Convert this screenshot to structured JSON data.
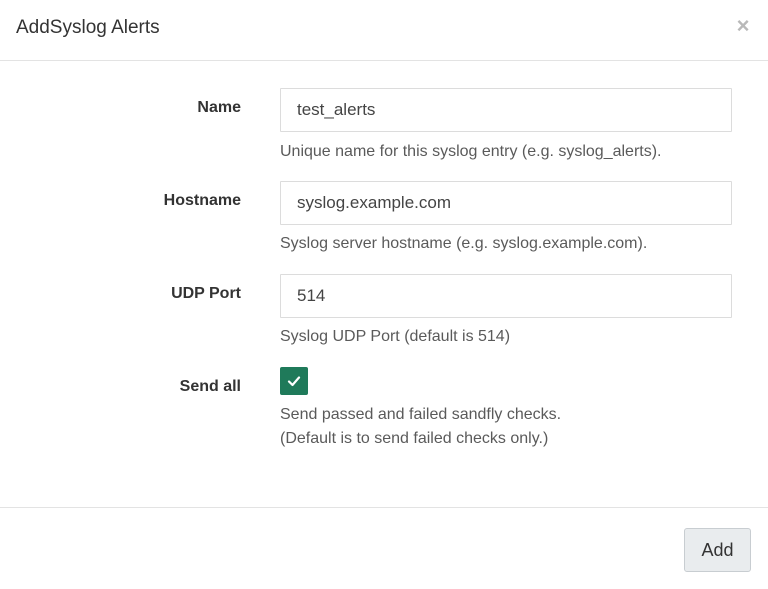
{
  "dialog": {
    "title": "AddSyslog Alerts",
    "close_symbol": "×"
  },
  "form": {
    "name": {
      "label": "Name",
      "value": "test_alerts",
      "help": "Unique name for this syslog entry (e.g. syslog_alerts)."
    },
    "hostname": {
      "label": "Hostname",
      "value": "syslog.example.com",
      "help": "Syslog server hostname (e.g. syslog.example.com)."
    },
    "udp_port": {
      "label": "UDP Port",
      "value": "514",
      "help": "Syslog UDP Port (default is 514)"
    },
    "send_all": {
      "label": "Send all",
      "checked": true,
      "help_line1": "Send passed and failed sandfly checks.",
      "help_line2": "(Default is to send failed checks only.)"
    }
  },
  "footer": {
    "add_label": "Add"
  },
  "colors": {
    "checkbox_fill": "#1f7a5a",
    "button_bg": "#e9ecee"
  },
  "icons": {
    "close": "close-icon",
    "check": "check-icon"
  }
}
